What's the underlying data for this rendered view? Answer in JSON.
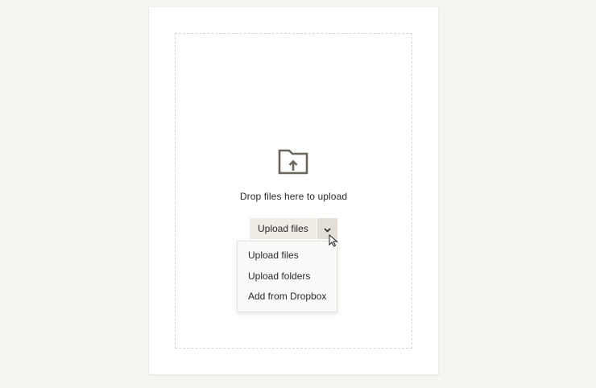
{
  "upload": {
    "drop_text": "Drop files here to upload",
    "button_label": "Upload files",
    "folder_icon": "folder-upload-icon",
    "caret_icon": "chevron-down-icon"
  },
  "menu": {
    "items": [
      {
        "label": "Upload files"
      },
      {
        "label": "Upload folders"
      },
      {
        "label": "Add from Dropbox"
      }
    ]
  },
  "colors": {
    "background": "#f6f5f1",
    "card": "#ffffff",
    "button": "#efece6",
    "icon": "#6b655c"
  }
}
